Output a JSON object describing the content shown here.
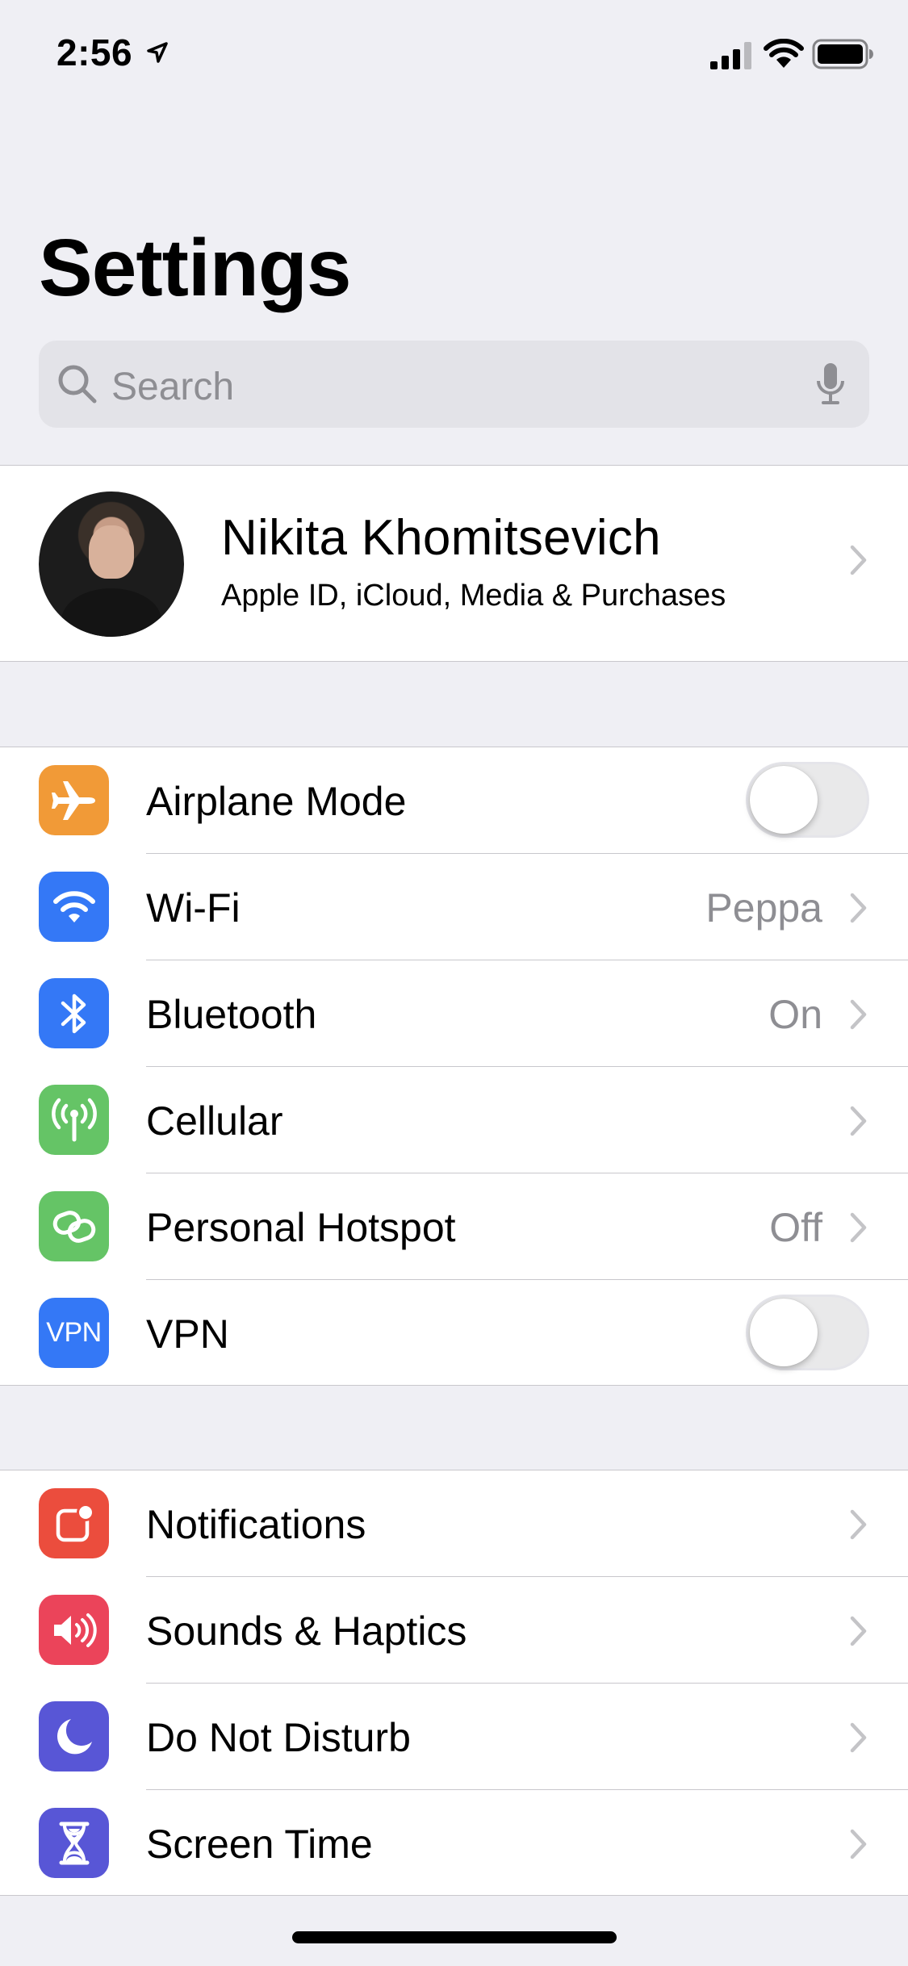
{
  "status_bar": {
    "time": "2:56"
  },
  "header": {
    "title": "Settings"
  },
  "search": {
    "placeholder": "Search"
  },
  "profile": {
    "name": "Nikita Khomitsevich",
    "subtitle": "Apple ID, iCloud, Media & Purchases"
  },
  "group1": [
    {
      "label": "Airplane Mode",
      "value": "",
      "control": "toggle",
      "toggle_on": false,
      "icon": "airplane-icon",
      "color": "#f19a37"
    },
    {
      "label": "Wi-Fi",
      "value": "Peppa",
      "control": "chevron",
      "icon": "wifi-icon",
      "color": "#3478f6"
    },
    {
      "label": "Bluetooth",
      "value": "On",
      "control": "chevron",
      "icon": "bluetooth-icon",
      "color": "#3478f6"
    },
    {
      "label": "Cellular",
      "value": "",
      "control": "chevron",
      "icon": "antenna-icon",
      "color": "#65c466"
    },
    {
      "label": "Personal Hotspot",
      "value": "Off",
      "control": "chevron",
      "icon": "hotspot-icon",
      "color": "#65c466"
    },
    {
      "label": "VPN",
      "value": "",
      "control": "toggle",
      "toggle_on": false,
      "icon": "vpn-icon",
      "icon_text": "VPN",
      "color": "#3478f6"
    }
  ],
  "group2": [
    {
      "label": "Notifications",
      "icon": "notifications-icon",
      "color": "#eb4d3d"
    },
    {
      "label": "Sounds & Haptics",
      "icon": "speaker-icon",
      "color": "#eb445a"
    },
    {
      "label": "Do Not Disturb",
      "icon": "moon-icon",
      "color": "#5856d6"
    },
    {
      "label": "Screen Time",
      "icon": "hourglass-icon",
      "color": "#5856d6"
    }
  ]
}
